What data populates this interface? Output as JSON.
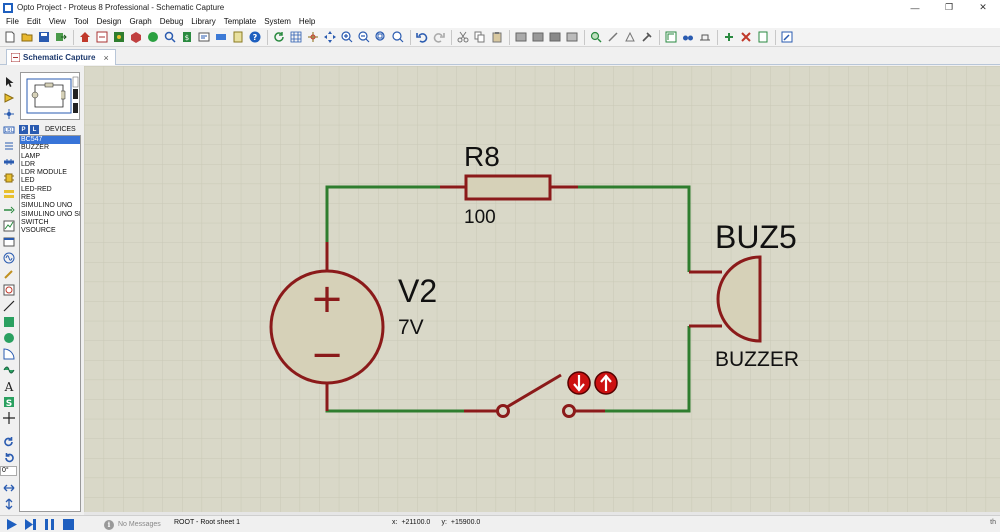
{
  "window": {
    "title": "Opto Project - Proteus 8 Professional - Schematic Capture",
    "controls": [
      "—",
      "❐",
      "✕"
    ]
  },
  "menu": [
    "File",
    "Edit",
    "View",
    "Tool",
    "Design",
    "Graph",
    "Debug",
    "Library",
    "Template",
    "System",
    "Help"
  ],
  "tab": {
    "label": "Schematic Capture",
    "close": "×"
  },
  "devices": {
    "pick_label": "P",
    "lib_label": "L",
    "title": "DEVICES",
    "items": [
      "BC547",
      "BUZZER",
      "LAMP",
      "LDR",
      "LDR MODULE",
      "LED",
      "LED-RED",
      "RES",
      "SIMULINO UNO",
      "SIMULINO UNO SH",
      "SWITCH",
      "VSOURCE"
    ],
    "selected_index": 0
  },
  "rotation": "0°",
  "schematic": {
    "resistor": {
      "ref": "R8",
      "value": "100"
    },
    "source": {
      "ref": "V2",
      "value": "7V",
      "plus": "+",
      "minus": "−"
    },
    "buzzer": {
      "ref": "BUZ5",
      "value": "BUZZER"
    },
    "colors": {
      "wire": "#2e7d2e",
      "pin": "#8b1a1a",
      "body_fill": "#d6d1b8",
      "grid_bg": "#d9d8c8",
      "grid_line": "#c9c8b6"
    }
  },
  "status": {
    "messages": "No Messages",
    "sheet": "ROOT - Root sheet 1",
    "x_label": "x:",
    "x_value": "+21100.0",
    "y_label": "y:",
    "y_value": "+15900.0",
    "end_mark": "th"
  }
}
